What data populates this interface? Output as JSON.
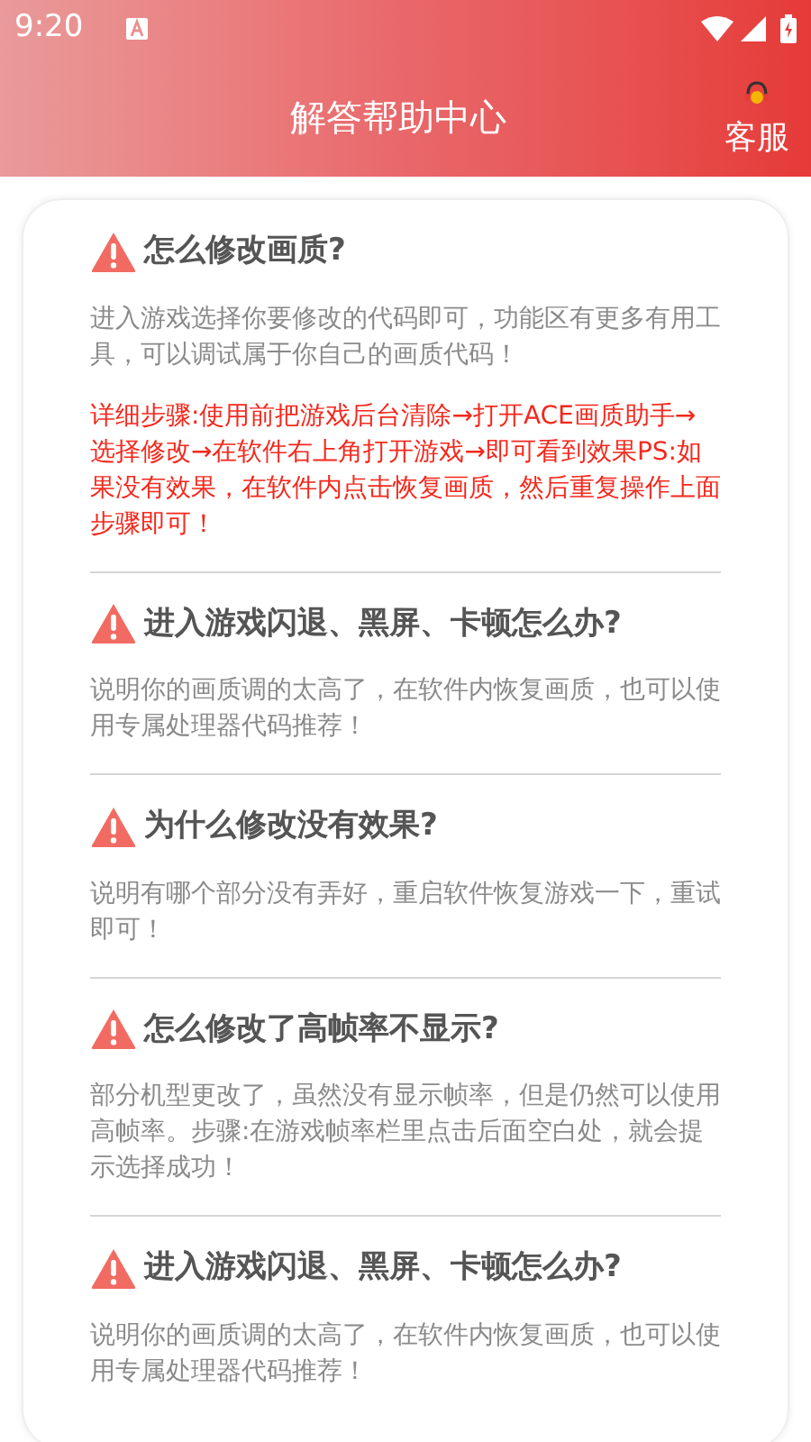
{
  "status_bar": {
    "time": "9:20"
  },
  "header": {
    "title": "解答帮助中心",
    "service_label": "客服"
  },
  "faq": [
    {
      "question": "怎么修改画质?",
      "paragraphs": [
        {
          "kind": "normal",
          "text": "进入游戏选择你要修改的代码即可，功能区有更多有用工具，可以调试属于你自己的画质代码！"
        },
        {
          "kind": "highlight",
          "text": "详细步骤:使用前把游戏后台清除→打开ACE画质助手→选择修改→在软件右上角打开游戏→即可看到效果PS:如果没有效果，在软件内点击恢复画质，然后重复操作上面步骤即可！"
        }
      ]
    },
    {
      "question": "进入游戏闪退、黑屏、卡顿怎么办?",
      "paragraphs": [
        {
          "kind": "normal",
          "text": "说明你的画质调的太高了，在软件内恢复画质，也可以使用专属处理器代码推荐！"
        }
      ]
    },
    {
      "question": "为什么修改没有效果?",
      "paragraphs": [
        {
          "kind": "normal",
          "text": "说明有哪个部分没有弄好，重启软件恢复游戏一下，重试即可！"
        }
      ]
    },
    {
      "question": "怎么修改了高帧率不显示?",
      "paragraphs": [
        {
          "kind": "normal",
          "text": "部分机型更改了，虽然没有显示帧率，但是仍然可以使用高帧率。步骤:在游戏帧率栏里点击后面空白处，就会提示选择成功！"
        }
      ]
    },
    {
      "question": "进入游戏闪退、黑屏、卡顿怎么办?",
      "paragraphs": [
        {
          "kind": "normal",
          "text": "说明你的画质调的太高了，在软件内恢复画质，也可以使用专属处理器代码推荐！"
        }
      ]
    }
  ]
}
